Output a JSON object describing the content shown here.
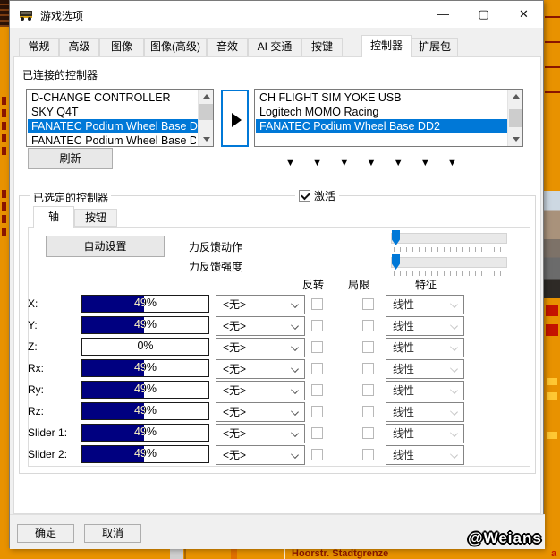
{
  "window": {
    "title": "游戏选项",
    "minimize_glyph": "—",
    "maximize_glyph": "▢",
    "close_glyph": "✕"
  },
  "tabs": {
    "items": [
      "常规",
      "高级",
      "图像",
      "图像(高级)",
      "音效",
      "AI 交通",
      "按键",
      "控制器",
      "扩展包"
    ],
    "active": "控制器"
  },
  "connected": {
    "label": "已连接的控制器",
    "device_list": [
      "D-CHANGE CONTROLLER",
      "SKY Q4T",
      "FANATEC Podium Wheel Base D",
      "FANATEC Podium Wheel Base D"
    ],
    "device_selected": "FANATEC Podium Wheel Base D",
    "assigned_list": [
      "CH FLIGHT SIM YOKE USB",
      "Logitech MOMO Racing",
      "FANATEC Podium Wheel Base DD2"
    ],
    "assigned_selected": "FANATEC Podium Wheel Base DD2",
    "refresh_label": "刷新",
    "arrow_glyph": "▼"
  },
  "selected_controller": {
    "group_label": "已选定的控制器",
    "activate_label": "激活",
    "activate_checked": true,
    "tab_axis": "轴",
    "tab_buttons": "按钮",
    "auto_setup_label": "自动设置",
    "ff_action_label": "力反馈动作",
    "ff_strength_label": "力反馈强度",
    "ff_action_value": 0,
    "ff_strength_value": 0,
    "col_invert": "反转",
    "col_limit": "局限",
    "col_characteristic": "特征",
    "none_option": "<无>",
    "linear_option": "线性",
    "axes": [
      {
        "name": "X:",
        "percent": "49%",
        "value": 49
      },
      {
        "name": "Y:",
        "percent": "49%",
        "value": 49
      },
      {
        "name": "Z:",
        "percent": "0%",
        "value": 0
      },
      {
        "name": "Rx:",
        "percent": "49%",
        "value": 49
      },
      {
        "name": "Ry:",
        "percent": "49%",
        "value": 49
      },
      {
        "name": "Rz:",
        "percent": "49%",
        "value": 49
      },
      {
        "name": "Slider 1:",
        "percent": "49%",
        "value": 49
      },
      {
        "name": "Slider 2:",
        "percent": "49%",
        "value": 49
      }
    ]
  },
  "footer": {
    "ok_label": "确定",
    "cancel_label": "取消"
  },
  "watermark": "@Weians",
  "background": {
    "bottom_text": "Hoorstr. Stadtgrenze"
  },
  "colors": {
    "selection_blue": "#0078D7",
    "bar_fill_navy": "#000080",
    "bar_text_light": "#FFF6C2",
    "game_orange": "#E89200",
    "game_dark_red": "#8A1500"
  }
}
